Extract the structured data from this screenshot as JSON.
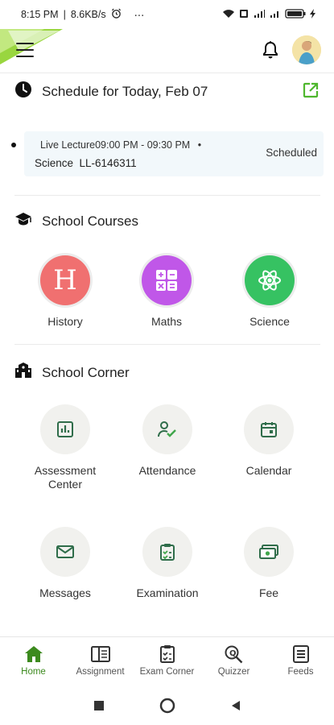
{
  "status_bar": {
    "time": "8:15 PM",
    "speed": "8.6KB/s",
    "more": "⋯"
  },
  "app_bar": {
    "menu_icon": "hamburger-menu-icon",
    "notification_icon": "bell-icon",
    "avatar_icon": "user-avatar"
  },
  "schedule": {
    "title": "Schedule for Today, Feb 07",
    "edit_icon": "external-edit-icon",
    "item": {
      "type_time": "Live Lecture09:00 PM - 09:30 PM",
      "bullet": "•",
      "course": "Science  LL-6146311",
      "status": "Scheduled"
    }
  },
  "school_courses": {
    "title": "School Courses",
    "items": [
      {
        "label": "History",
        "glyph": "H",
        "color": "#f07070"
      },
      {
        "label": "Maths",
        "glyph": "calculator-icon",
        "color": "#c057e8"
      },
      {
        "label": "Science",
        "glyph": "atom-icon",
        "color": "#36c262"
      }
    ]
  },
  "school_corner": {
    "title": "School Corner",
    "items": [
      {
        "label": "Assessment Center",
        "icon": "bar-chart-icon"
      },
      {
        "label": "Attendance",
        "icon": "user-check-icon"
      },
      {
        "label": "Calendar",
        "icon": "calendar-icon"
      },
      {
        "label": "Messages",
        "icon": "mail-icon"
      },
      {
        "label": "Examination",
        "icon": "clipboard-check-icon"
      },
      {
        "label": "Fee",
        "icon": "cash-icon"
      }
    ]
  },
  "bottom_nav": {
    "items": [
      {
        "label": "Home",
        "icon": "home-icon",
        "active": true
      },
      {
        "label": "Assignment",
        "icon": "book-icon",
        "active": false
      },
      {
        "label": "Exam Corner",
        "icon": "exam-sheet-icon",
        "active": false
      },
      {
        "label": "Quizzer",
        "icon": "quiz-search-icon",
        "active": false
      },
      {
        "label": "Feeds",
        "icon": "feed-list-icon",
        "active": false
      }
    ]
  },
  "colors": {
    "accent_green": "#3c8a1e",
    "icon_green": "#2f6d4a",
    "history": "#f07070",
    "maths": "#c057e8",
    "science": "#36c262"
  }
}
